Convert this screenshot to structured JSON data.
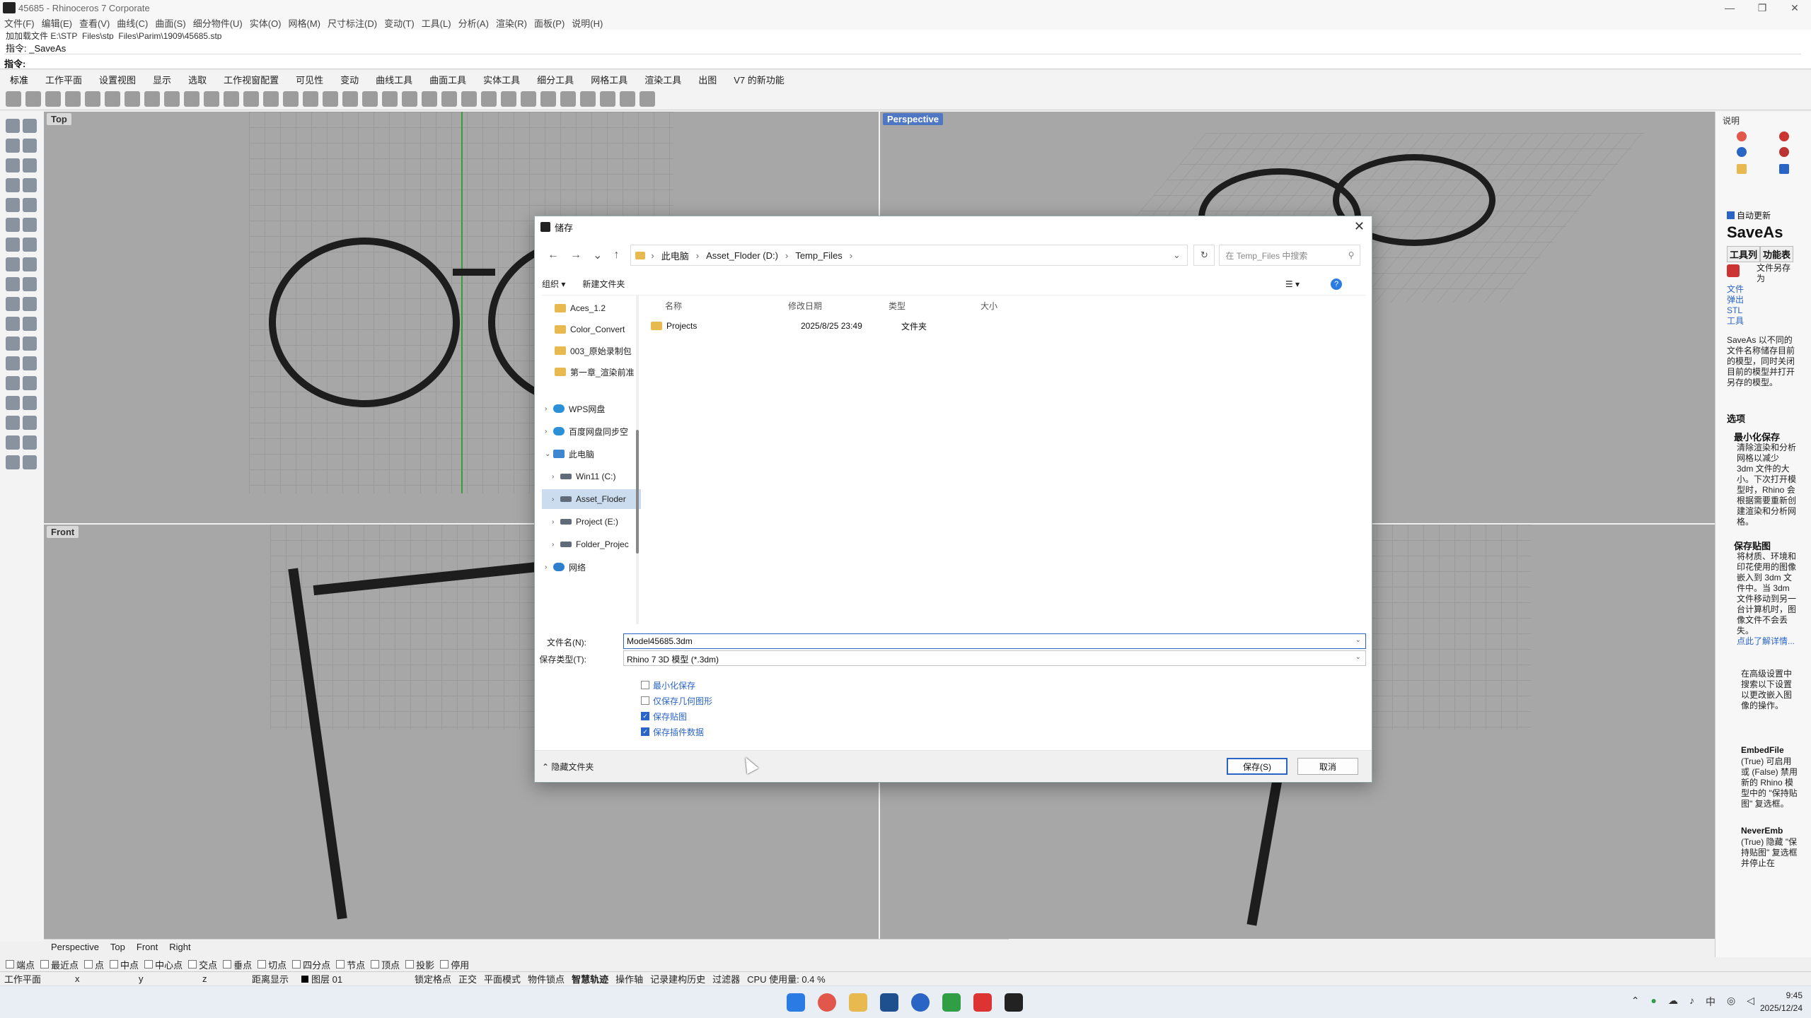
{
  "app": {
    "title": "45685 - Rhinoceros 7 Corporate",
    "window_buttons": [
      "—",
      "❐",
      "✕"
    ]
  },
  "menu": [
    "文件(F)",
    "编辑(E)",
    "查看(V)",
    "曲线(C)",
    "曲面(S)",
    "细分物件(U)",
    "实体(O)",
    "网格(M)",
    "尺寸标注(D)",
    "变动(T)",
    "工具(L)",
    "分析(A)",
    "渲染(R)",
    "面板(P)",
    "说明(H)"
  ],
  "command": {
    "history": "加加载文件 E:\\STP_Files\\stp_Files\\Parim\\1909\\45685.stp",
    "last": "指令: _SaveAs",
    "prompt": "指令:"
  },
  "toolbar_tabs": [
    "标准",
    "工作平面",
    "设置视图",
    "显示",
    "选取",
    "工作视窗配置",
    "可见性",
    "变动",
    "曲线工具",
    "曲面工具",
    "实体工具",
    "细分工具",
    "网格工具",
    "渲染工具",
    "出图",
    "V7 的新功能"
  ],
  "viewports": {
    "top": "Top",
    "perspective": "Perspective",
    "front": "Front"
  },
  "viewport_tabs": [
    "Perspective",
    "Top",
    "Front",
    "Right"
  ],
  "osnaps": [
    "端点",
    "最近点",
    "点",
    "中点",
    "中心点",
    "交点",
    "垂点",
    "切点",
    "四分点",
    "节点",
    "顶点",
    "投影",
    "停用"
  ],
  "status": {
    "cplane": "工作平面",
    "x": "x",
    "y": "y",
    "z": "z",
    "distance": "距离显示",
    "layer": "图层 01",
    "toggles": [
      "锁定格点",
      "正交",
      "平面模式",
      "物件锁点",
      "智慧轨迹",
      "操作轴",
      "记录建构历史",
      "过滤器"
    ],
    "cpu": "CPU 使用量: 0.4 %"
  },
  "taskbar": {
    "time": "9:45",
    "date": "2025/12/24",
    "ime": "中"
  },
  "right_panel": {
    "header": "说明",
    "auto_update": "自动更新",
    "command_name": "SaveAs",
    "tabs": [
      "工具列",
      "功能表"
    ],
    "tool_desc": "文件另存为",
    "tool_links": "文件 弹出 STL 工具",
    "description": "SaveAs 以不同的文件名称储存目前的模型，同时关闭目前的模型并打开另存的模型。",
    "options_title": "选项",
    "opt1_title": "最小化保存",
    "opt1_desc": "清除渲染和分析网格以减少 3dm 文件的大小。下次打开模型时，Rhino 会根据需要重新创建渲染和分析网格。",
    "opt2_title": "保存贴图",
    "opt2_desc": "将材质、环境和印花使用的图像嵌入到 3dm 文件中。当 3dm 文件移动到另一台计算机时，图像文件不会丢失。",
    "opt2_link": "点此了解详情...",
    "bullet": "在高级设置中搜索以下设置以更改嵌入图像的操作。",
    "embed_title": "EmbedFile",
    "embed_desc": "(True) 可启用或 (False) 禁用新的 Rhino 模型中的 \"保持贴图\" 复选框。",
    "never_title": "NeverEmb",
    "never_desc": "(True) 隐藏 \"保持贴图\" 复选框并停止在"
  },
  "dialog": {
    "title": "储存",
    "breadcrumb": [
      "此电脑",
      "Asset_Floder (D:)",
      "Temp_Files"
    ],
    "search_placeholder": "在 Temp_Files 中搜索",
    "organize": "组织 ▾",
    "new_folder": "新建文件夹",
    "nav": [
      {
        "label": "Aces_1.2",
        "type": "folder"
      },
      {
        "label": "Color_Convert",
        "type": "folder"
      },
      {
        "label": "003_原始录制包",
        "type": "folder"
      },
      {
        "label": "第一章_渲染前准",
        "type": "folder"
      },
      {
        "label": "WPS网盘",
        "type": "cloud"
      },
      {
        "label": "百度网盘同步空",
        "type": "cloud"
      },
      {
        "label": "此电脑",
        "type": "pc"
      },
      {
        "label": "Win11 (C:)",
        "type": "drive"
      },
      {
        "label": "Asset_Floder",
        "type": "drive"
      },
      {
        "label": "Project (E:)",
        "type": "drive"
      },
      {
        "label": "Folder_Projec",
        "type": "drive"
      },
      {
        "label": "网络",
        "type": "net"
      }
    ],
    "columns": [
      "名称",
      "修改日期",
      "类型",
      "大小"
    ],
    "files": [
      {
        "name": "Projects",
        "modified": "2025/8/25 23:49",
        "type": "文件夹",
        "size": ""
      }
    ],
    "filename_label": "文件名(N):",
    "filename": "Model45685.3dm",
    "filetype_label": "保存类型(T):",
    "filetype": "Rhino 7 3D 模型 (*.3dm)",
    "options": [
      {
        "label": "最小化保存",
        "checked": false
      },
      {
        "label": "仅保存几何图形",
        "checked": false
      },
      {
        "label": "保存贴图",
        "checked": true
      },
      {
        "label": "保存插件数据",
        "checked": true
      }
    ],
    "hide_folders": "隐藏文件夹",
    "save": "保存(S)",
    "cancel": "取消"
  }
}
